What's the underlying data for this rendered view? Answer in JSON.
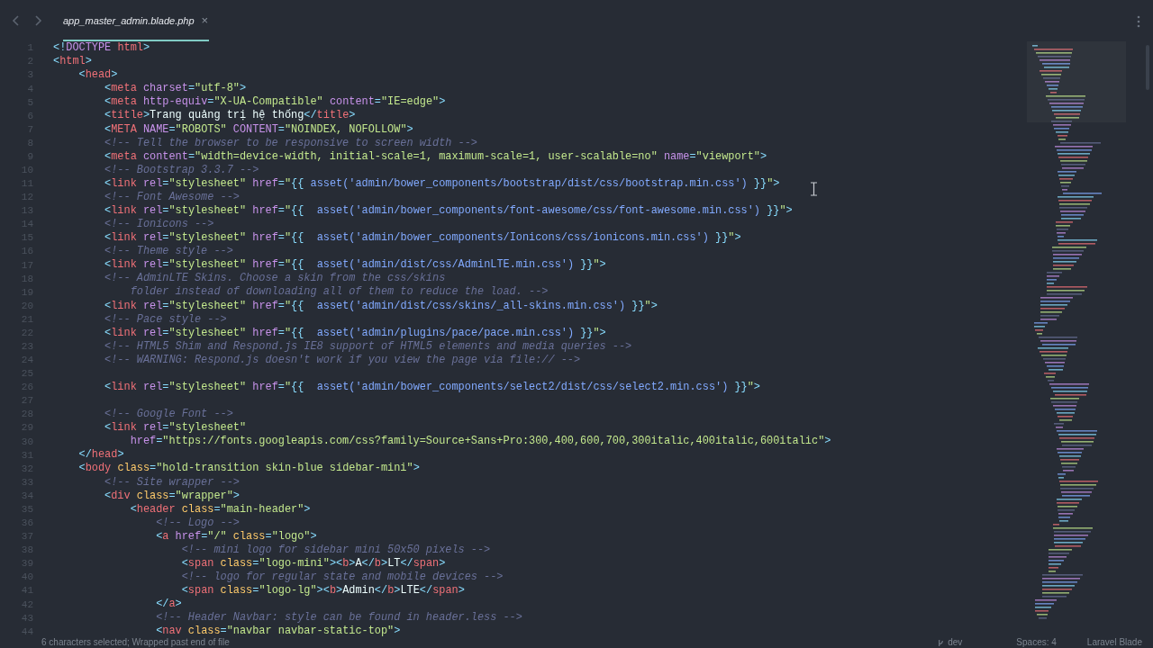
{
  "tab": {
    "title": "app_master_admin.blade.php",
    "close": "×",
    "selected": true
  },
  "lines": [
    {
      "n": "1",
      "code": [
        {
          "kind": "p",
          "text": "<!"
        },
        {
          "kind": "doc",
          "text": "DOCTYPE "
        },
        {
          "kind": "tag",
          "text": "html"
        },
        {
          "kind": "p",
          "text": ">"
        }
      ]
    },
    {
      "n": "2",
      "code": [
        {
          "kind": "p",
          "text": "<"
        },
        {
          "kind": "tag",
          "text": "html"
        },
        {
          "kind": "p",
          "text": ">"
        }
      ]
    },
    {
      "n": "3",
      "code": [
        {
          "kind": "p",
          "text": "    <"
        },
        {
          "kind": "tag",
          "text": "head"
        },
        {
          "kind": "p",
          "text": ">"
        }
      ]
    },
    {
      "n": "4",
      "code": [
        {
          "kind": "p",
          "text": "        <"
        },
        {
          "kind": "tag",
          "text": "meta "
        },
        {
          "kind": "attr",
          "text": "charset"
        },
        {
          "kind": "p",
          "text": "="
        },
        {
          "kind": "str",
          "text": "\"utf-8\""
        },
        {
          "kind": "p",
          "text": ">"
        }
      ]
    },
    {
      "n": "5",
      "code": [
        {
          "kind": "p",
          "text": "        <"
        },
        {
          "kind": "tag",
          "text": "meta "
        },
        {
          "kind": "attr",
          "text": "http-equiv"
        },
        {
          "kind": "p",
          "text": "="
        },
        {
          "kind": "str",
          "text": "\"X-UA-Compatible\" "
        },
        {
          "kind": "attr",
          "text": "content"
        },
        {
          "kind": "p",
          "text": "="
        },
        {
          "kind": "str",
          "text": "\"IE=edge\""
        },
        {
          "kind": "p",
          "text": ">"
        }
      ]
    },
    {
      "n": "6",
      "code": [
        {
          "kind": "p",
          "text": "        <"
        },
        {
          "kind": "tag",
          "text": "title"
        },
        {
          "kind": "p",
          "text": ">"
        },
        {
          "kind": "txt",
          "text": "Trang quảng trị hệ thống"
        },
        {
          "kind": "p",
          "text": "</"
        },
        {
          "kind": "tag",
          "text": "title"
        },
        {
          "kind": "p",
          "text": ">"
        }
      ]
    },
    {
      "n": "7",
      "code": [
        {
          "kind": "p",
          "text": "        <"
        },
        {
          "kind": "tag",
          "text": "META "
        },
        {
          "kind": "attr",
          "text": "NAME"
        },
        {
          "kind": "p",
          "text": "="
        },
        {
          "kind": "str",
          "text": "\"ROBOTS\" "
        },
        {
          "kind": "attr",
          "text": "CONTENT"
        },
        {
          "kind": "p",
          "text": "="
        },
        {
          "kind": "str",
          "text": "\"NOINDEX, NOFOLLOW\""
        },
        {
          "kind": "p",
          "text": ">"
        }
      ]
    },
    {
      "n": "8",
      "code": [
        {
          "kind": "com",
          "text": "        <!-- Tell the browser to be responsive to screen width -->"
        }
      ]
    },
    {
      "n": "9",
      "code": [
        {
          "kind": "p",
          "text": "        <"
        },
        {
          "kind": "tag",
          "text": "meta "
        },
        {
          "kind": "attr",
          "text": "content"
        },
        {
          "kind": "p",
          "text": "="
        },
        {
          "kind": "str",
          "text": "\"width=device-width, initial-scale=1, maximum-scale=1, user-scalable=no\" "
        },
        {
          "kind": "attr",
          "text": "name"
        },
        {
          "kind": "p",
          "text": "="
        },
        {
          "kind": "str",
          "text": "\"viewport\""
        },
        {
          "kind": "p",
          "text": ">"
        }
      ]
    },
    {
      "n": "10",
      "code": [
        {
          "kind": "com",
          "text": "        <!-- Bootstrap 3.3.7 -->"
        }
      ]
    },
    {
      "n": "11",
      "code": [
        {
          "kind": "p",
          "text": "        <"
        },
        {
          "kind": "tag",
          "text": "link "
        },
        {
          "kind": "attr",
          "text": "rel"
        },
        {
          "kind": "p",
          "text": "="
        },
        {
          "kind": "str",
          "text": "\"stylesheet\" "
        },
        {
          "kind": "attr",
          "text": "href"
        },
        {
          "kind": "p",
          "text": "="
        },
        {
          "kind": "str",
          "text": "\""
        },
        {
          "kind": "p",
          "text": "{{ "
        },
        {
          "kind": "fn",
          "text": "asset('admin/bower_components/bootstrap/dist/css/bootstrap.min.css') "
        },
        {
          "kind": "p",
          "text": "}}"
        },
        {
          "kind": "str",
          "text": "\""
        },
        {
          "kind": "p",
          "text": ">"
        }
      ]
    },
    {
      "n": "12",
      "code": [
        {
          "kind": "com",
          "text": "        <!-- Font Awesome -->"
        }
      ]
    },
    {
      "n": "13",
      "code": [
        {
          "kind": "p",
          "text": "        <"
        },
        {
          "kind": "tag",
          "text": "link "
        },
        {
          "kind": "attr",
          "text": "rel"
        },
        {
          "kind": "p",
          "text": "="
        },
        {
          "kind": "str",
          "text": "\"stylesheet\" "
        },
        {
          "kind": "attr",
          "text": "href"
        },
        {
          "kind": "p",
          "text": "="
        },
        {
          "kind": "str",
          "text": "\""
        },
        {
          "kind": "p",
          "text": "{{  "
        },
        {
          "kind": "fn",
          "text": "asset('admin/bower_components/font-awesome/css/font-awesome.min.css') "
        },
        {
          "kind": "p",
          "text": "}}"
        },
        {
          "kind": "str",
          "text": "\""
        },
        {
          "kind": "p",
          "text": ">"
        }
      ]
    },
    {
      "n": "14",
      "code": [
        {
          "kind": "com",
          "text": "        <!-- Ionicons -->"
        }
      ]
    },
    {
      "n": "15",
      "code": [
        {
          "kind": "p",
          "text": "        <"
        },
        {
          "kind": "tag",
          "text": "link "
        },
        {
          "kind": "attr",
          "text": "rel"
        },
        {
          "kind": "p",
          "text": "="
        },
        {
          "kind": "str",
          "text": "\"stylesheet\" "
        },
        {
          "kind": "attr",
          "text": "href"
        },
        {
          "kind": "p",
          "text": "="
        },
        {
          "kind": "str",
          "text": "\""
        },
        {
          "kind": "p",
          "text": "{{  "
        },
        {
          "kind": "fn",
          "text": "asset('admin/bower_components/Ionicons/css/ionicons.min.css') "
        },
        {
          "kind": "p",
          "text": "}}"
        },
        {
          "kind": "str",
          "text": "\""
        },
        {
          "kind": "p",
          "text": ">"
        }
      ]
    },
    {
      "n": "16",
      "code": [
        {
          "kind": "com",
          "text": "        <!-- Theme style -->"
        }
      ]
    },
    {
      "n": "17",
      "code": [
        {
          "kind": "p",
          "text": "        <"
        },
        {
          "kind": "tag",
          "text": "link "
        },
        {
          "kind": "attr",
          "text": "rel"
        },
        {
          "kind": "p",
          "text": "="
        },
        {
          "kind": "str",
          "text": "\"stylesheet\" "
        },
        {
          "kind": "attr",
          "text": "href"
        },
        {
          "kind": "p",
          "text": "="
        },
        {
          "kind": "str",
          "text": "\""
        },
        {
          "kind": "p",
          "text": "{{  "
        },
        {
          "kind": "fn",
          "text": "asset('admin/dist/css/AdminLTE.min.css') "
        },
        {
          "kind": "p",
          "text": "}}"
        },
        {
          "kind": "str",
          "text": "\""
        },
        {
          "kind": "p",
          "text": ">"
        }
      ]
    },
    {
      "n": "18",
      "code": [
        {
          "kind": "com",
          "text": "        <!-- AdminLTE Skins. Choose a skin from the css/skins"
        }
      ]
    },
    {
      "n": "19",
      "code": [
        {
          "kind": "com",
          "text": "            folder instead of downloading all of them to reduce the load. -->"
        }
      ]
    },
    {
      "n": "20",
      "code": [
        {
          "kind": "p",
          "text": "        <"
        },
        {
          "kind": "tag",
          "text": "link "
        },
        {
          "kind": "attr",
          "text": "rel"
        },
        {
          "kind": "p",
          "text": "="
        },
        {
          "kind": "str",
          "text": "\"stylesheet\" "
        },
        {
          "kind": "attr",
          "text": "href"
        },
        {
          "kind": "p",
          "text": "="
        },
        {
          "kind": "str",
          "text": "\""
        },
        {
          "kind": "p",
          "text": "{{  "
        },
        {
          "kind": "fn",
          "text": "asset('admin/dist/css/skins/_all-skins.min.css') "
        },
        {
          "kind": "p",
          "text": "}}"
        },
        {
          "kind": "str",
          "text": "\""
        },
        {
          "kind": "p",
          "text": ">"
        }
      ]
    },
    {
      "n": "21",
      "code": [
        {
          "kind": "com",
          "text": "        <!-- Pace style -->"
        }
      ]
    },
    {
      "n": "22",
      "code": [
        {
          "kind": "p",
          "text": "        <"
        },
        {
          "kind": "tag",
          "text": "link "
        },
        {
          "kind": "attr",
          "text": "rel"
        },
        {
          "kind": "p",
          "text": "="
        },
        {
          "kind": "str",
          "text": "\"stylesheet\" "
        },
        {
          "kind": "attr",
          "text": "href"
        },
        {
          "kind": "p",
          "text": "="
        },
        {
          "kind": "str",
          "text": "\""
        },
        {
          "kind": "p",
          "text": "{{  "
        },
        {
          "kind": "fn",
          "text": "asset('admin/plugins/pace/pace.min.css') "
        },
        {
          "kind": "p",
          "text": "}}"
        },
        {
          "kind": "str",
          "text": "\""
        },
        {
          "kind": "p",
          "text": ">"
        }
      ]
    },
    {
      "n": "23",
      "code": [
        {
          "kind": "com",
          "text": "        <!-- HTML5 Shim and Respond.js IE8 support of HTML5 elements and media queries -->"
        }
      ]
    },
    {
      "n": "24",
      "code": [
        {
          "kind": "com",
          "text": "        <!-- WARNING: Respond.js doesn't work if you view the page via file:// -->"
        }
      ]
    },
    {
      "n": "25"
    },
    {
      "n": "26",
      "code": [
        {
          "kind": "p",
          "text": "        <"
        },
        {
          "kind": "tag",
          "text": "link "
        },
        {
          "kind": "attr",
          "text": "rel"
        },
        {
          "kind": "p",
          "text": "="
        },
        {
          "kind": "str",
          "text": "\"stylesheet\" "
        },
        {
          "kind": "attr",
          "text": "href"
        },
        {
          "kind": "p",
          "text": "="
        },
        {
          "kind": "str",
          "text": "\""
        },
        {
          "kind": "p",
          "text": "{{  "
        },
        {
          "kind": "fn",
          "text": "asset('admin/bower_components/select2/dist/css/select2.min.css') "
        },
        {
          "kind": "p",
          "text": "}}"
        },
        {
          "kind": "str",
          "text": "\""
        },
        {
          "kind": "p",
          "text": ">"
        }
      ]
    },
    {
      "n": "27"
    },
    {
      "n": "28",
      "code": [
        {
          "kind": "com",
          "text": "        <!-- Google Font -->"
        }
      ]
    },
    {
      "n": "29",
      "code": [
        {
          "kind": "p",
          "text": "        <"
        },
        {
          "kind": "tag",
          "text": "link "
        },
        {
          "kind": "attr",
          "text": "rel"
        },
        {
          "kind": "p",
          "text": "="
        },
        {
          "kind": "str",
          "text": "\"stylesheet\""
        }
      ]
    },
    {
      "n": "30",
      "code": [
        {
          "kind": "attr",
          "text": "            href"
        },
        {
          "kind": "p",
          "text": "="
        },
        {
          "kind": "str",
          "text": "\"https://fonts.googleapis.com/css?family=Source+Sans+Pro:300,400,600,700,300italic,400italic,600italic\""
        },
        {
          "kind": "p",
          "text": ">"
        }
      ]
    },
    {
      "n": "31",
      "code": [
        {
          "kind": "p",
          "text": "    </"
        },
        {
          "kind": "tag",
          "text": "head"
        },
        {
          "kind": "p",
          "text": ">"
        }
      ]
    },
    {
      "n": "32",
      "code": [
        {
          "kind": "p",
          "text": "    <"
        },
        {
          "kind": "tag",
          "text": "body "
        },
        {
          "kind": "cls",
          "text": "class"
        },
        {
          "kind": "p",
          "text": "="
        },
        {
          "kind": "str",
          "text": "\"hold-transition skin-blue sidebar-mini\""
        },
        {
          "kind": "p",
          "text": ">"
        }
      ]
    },
    {
      "n": "33",
      "code": [
        {
          "kind": "com",
          "text": "        <!-- Site wrapper -->"
        }
      ]
    },
    {
      "n": "34",
      "code": [
        {
          "kind": "p",
          "text": "        <"
        },
        {
          "kind": "tag",
          "text": "div "
        },
        {
          "kind": "cls",
          "text": "class"
        },
        {
          "kind": "p",
          "text": "="
        },
        {
          "kind": "str",
          "text": "\"wrapper\""
        },
        {
          "kind": "p",
          "text": ">"
        }
      ]
    },
    {
      "n": "35",
      "code": [
        {
          "kind": "p",
          "text": "            <"
        },
        {
          "kind": "tag",
          "text": "header "
        },
        {
          "kind": "cls",
          "text": "class"
        },
        {
          "kind": "p",
          "text": "="
        },
        {
          "kind": "str",
          "text": "\"main-header\""
        },
        {
          "kind": "p",
          "text": ">"
        }
      ]
    },
    {
      "n": "36",
      "code": [
        {
          "kind": "com",
          "text": "                <!-- Logo -->"
        }
      ]
    },
    {
      "n": "37",
      "code": [
        {
          "kind": "p",
          "text": "                <"
        },
        {
          "kind": "tag",
          "text": "a "
        },
        {
          "kind": "attr",
          "text": "href"
        },
        {
          "kind": "p",
          "text": "="
        },
        {
          "kind": "str",
          "text": "\"/\" "
        },
        {
          "kind": "cls",
          "text": "class"
        },
        {
          "kind": "p",
          "text": "="
        },
        {
          "kind": "str",
          "text": "\"logo\""
        },
        {
          "kind": "p",
          "text": ">"
        }
      ]
    },
    {
      "n": "38",
      "code": [
        {
          "kind": "com",
          "text": "                    <!-- mini logo for sidebar mini 50x50 pixels -->"
        }
      ]
    },
    {
      "n": "39",
      "code": [
        {
          "kind": "p",
          "text": "                    <"
        },
        {
          "kind": "tag",
          "text": "span "
        },
        {
          "kind": "cls",
          "text": "class"
        },
        {
          "kind": "p",
          "text": "="
        },
        {
          "kind": "str",
          "text": "\"logo-mini\""
        },
        {
          "kind": "p",
          "text": "><"
        },
        {
          "kind": "tag",
          "text": "b"
        },
        {
          "kind": "p",
          "text": ">"
        },
        {
          "kind": "txt",
          "text": "A"
        },
        {
          "kind": "p",
          "text": "</"
        },
        {
          "kind": "tag",
          "text": "b"
        },
        {
          "kind": "p",
          "text": ">"
        },
        {
          "kind": "txt",
          "text": "LT"
        },
        {
          "kind": "p",
          "text": "</"
        },
        {
          "kind": "tag",
          "text": "span"
        },
        {
          "kind": "p",
          "text": ">"
        }
      ]
    },
    {
      "n": "40",
      "code": [
        {
          "kind": "com",
          "text": "                    <!-- logo for regular state and mobile devices -->"
        }
      ]
    },
    {
      "n": "41",
      "code": [
        {
          "kind": "p",
          "text": "                    <"
        },
        {
          "kind": "tag",
          "text": "span "
        },
        {
          "kind": "cls",
          "text": "class"
        },
        {
          "kind": "p",
          "text": "="
        },
        {
          "kind": "str",
          "text": "\"logo-lg\""
        },
        {
          "kind": "p",
          "text": "><"
        },
        {
          "kind": "tag",
          "text": "b"
        },
        {
          "kind": "p",
          "text": ">"
        },
        {
          "kind": "txt",
          "text": "Admin"
        },
        {
          "kind": "p",
          "text": "</"
        },
        {
          "kind": "tag",
          "text": "b"
        },
        {
          "kind": "p",
          "text": ">"
        },
        {
          "kind": "txt",
          "text": "LTE"
        },
        {
          "kind": "p",
          "text": "</"
        },
        {
          "kind": "tag",
          "text": "span"
        },
        {
          "kind": "p",
          "text": ">"
        }
      ]
    },
    {
      "n": "42",
      "code": [
        {
          "kind": "p",
          "text": "                </"
        },
        {
          "kind": "tag",
          "text": "a"
        },
        {
          "kind": "p",
          "text": ">"
        }
      ]
    },
    {
      "n": "43",
      "code": [
        {
          "kind": "com",
          "text": "                <!-- Header Navbar: style can be found in header.less -->"
        }
      ]
    },
    {
      "n": "44",
      "code": [
        {
          "kind": "p",
          "text": "                <"
        },
        {
          "kind": "tag",
          "text": "nav "
        },
        {
          "kind": "cls",
          "text": "class"
        },
        {
          "kind": "p",
          "text": "="
        },
        {
          "kind": "str",
          "text": "\"navbar navbar-static-top\""
        },
        {
          "kind": "p",
          "text": ">"
        }
      ]
    }
  ],
  "status_bar": {
    "selection": "6 characters selected; Wrapped past end of file",
    "branch": "dev",
    "indentation": "Spaces: 4",
    "syntax": "Laravel Blade"
  }
}
